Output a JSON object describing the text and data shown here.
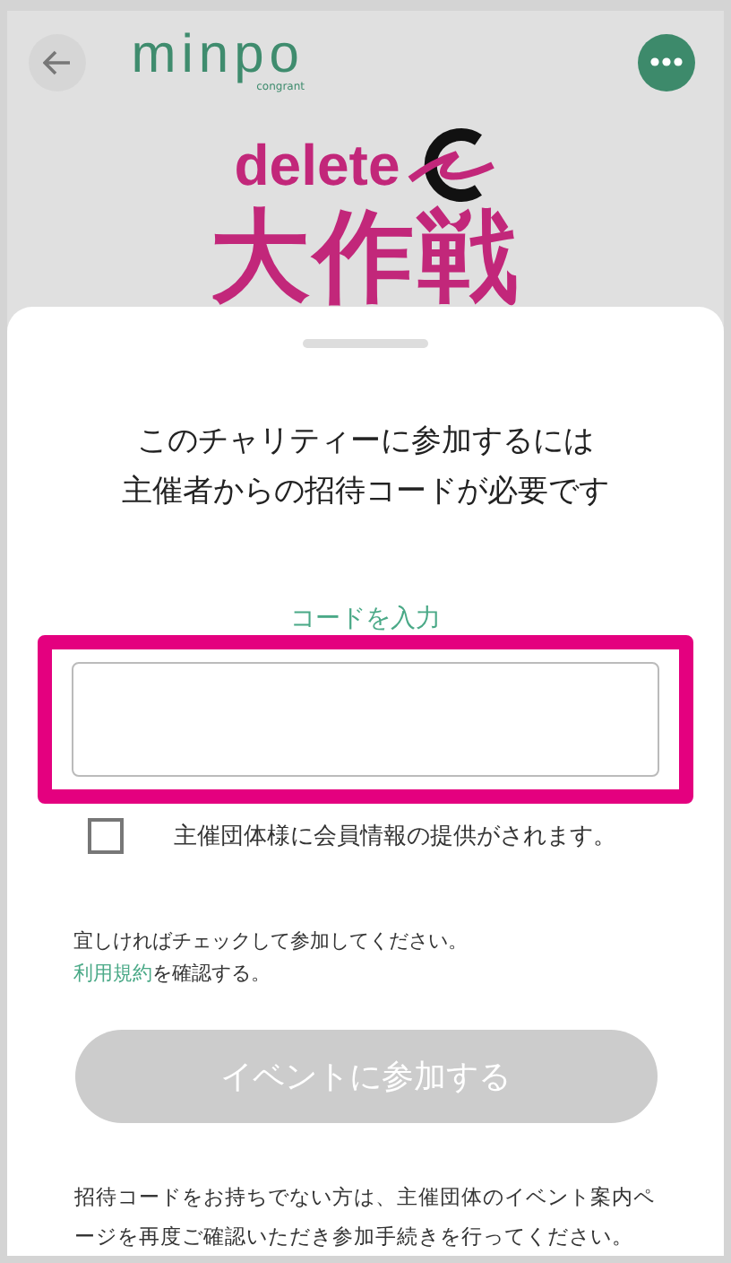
{
  "header": {
    "logo": {
      "name": "minpo",
      "sub": "congrant"
    }
  },
  "banner": {
    "line1": "delete",
    "line2": "大作戦"
  },
  "sheet": {
    "title_lines": [
      "このチャリティーに参加するには",
      "主催者からの招待コードが必要です"
    ],
    "code_field": {
      "label": "コードを入力",
      "highlighted": true
    },
    "consent": {
      "label": "主催団体様に会員情報の提供がされます。",
      "checked": false
    },
    "note": {
      "text": "宜しければチェックして参加してください。",
      "link": "利用規約",
      "link_suffix": "を確認する。"
    },
    "join_button": {
      "label": "イベントに参加する",
      "disabled": true
    },
    "footer": "招待コードをお持ちでない方は、主催団体のイベント案内ページを再度ご確認いただき参加手続きを行ってください。"
  }
}
